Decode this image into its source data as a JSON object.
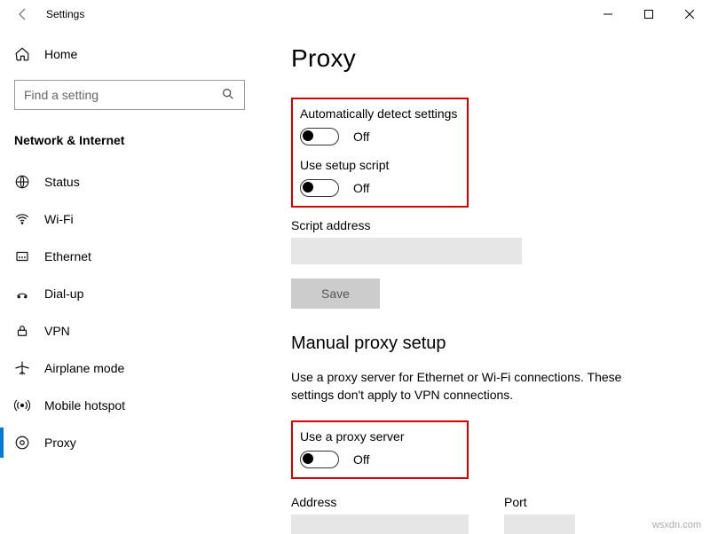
{
  "window": {
    "title": "Settings"
  },
  "sidebar": {
    "home": "Home",
    "search_placeholder": "Find a setting",
    "category": "Network & Internet",
    "items": [
      {
        "label": "Status"
      },
      {
        "label": "Wi-Fi"
      },
      {
        "label": "Ethernet"
      },
      {
        "label": "Dial-up"
      },
      {
        "label": "VPN"
      },
      {
        "label": "Airplane mode"
      },
      {
        "label": "Mobile hotspot"
      },
      {
        "label": "Proxy"
      }
    ]
  },
  "page": {
    "title": "Proxy",
    "auto": {
      "detect_label": "Automatically detect settings",
      "detect_state": "Off",
      "script_label": "Use setup script",
      "script_state": "Off",
      "script_address_label": "Script address",
      "save": "Save"
    },
    "manual": {
      "heading": "Manual proxy setup",
      "desc": "Use a proxy server for Ethernet or Wi-Fi connections. These settings don't apply to VPN connections.",
      "use_label": "Use a proxy server",
      "use_state": "Off",
      "address_label": "Address",
      "port_label": "Port"
    }
  },
  "watermark": "wsxdn.com"
}
